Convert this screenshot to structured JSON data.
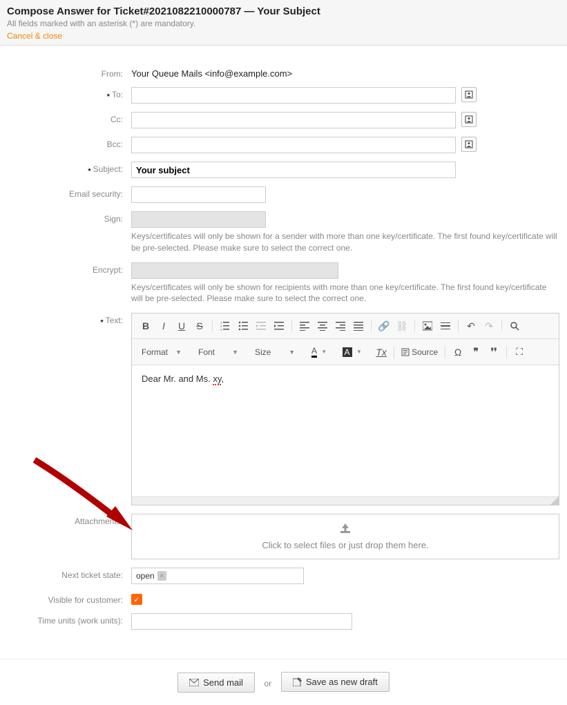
{
  "header": {
    "title": "Compose Answer for Ticket#2021082210000787 — Your Subject",
    "mandatory_note": "All fields marked with an asterisk (*) are mandatory.",
    "cancel_link": "Cancel & close"
  },
  "labels": {
    "from": "From:",
    "to": "To:",
    "cc": "Cc:",
    "bcc": "Bcc:",
    "subject": "Subject:",
    "email_security": "Email security:",
    "sign": "Sign:",
    "encrypt": "Encrypt:",
    "text": "Text:",
    "attachments": "Attachments:",
    "next_state": "Next ticket state:",
    "visible": "Visible for customer:",
    "time_units": "Time units (work units):"
  },
  "from_value": "Your Queue Mails <info@example.com>",
  "subject_value": "Your subject",
  "sign_help": "Keys/certificates will only be shown for a sender with more than one key/certificate. The first found key/certificate will be pre-selected. Please make sure to select the correct one.",
  "encrypt_help": "Keys/certificates will only be shown for recipients with more than one key/certificate. The first found key/certificate will be pre-selected. Please make sure to select the correct one.",
  "editor": {
    "format_label": "Format",
    "font_label": "Font",
    "size_label": "Size",
    "letter_a": "A",
    "tx_label": "Tx",
    "source_label": "Source",
    "content_prefix": "Dear Mr. and Ms. ",
    "content_spelled": "xy",
    "content_suffix": ","
  },
  "attachments_text": "Click to select files or just drop them here.",
  "next_state_value": "open",
  "footer": {
    "send": "Send mail",
    "or": "or",
    "draft": "Save as new draft"
  }
}
